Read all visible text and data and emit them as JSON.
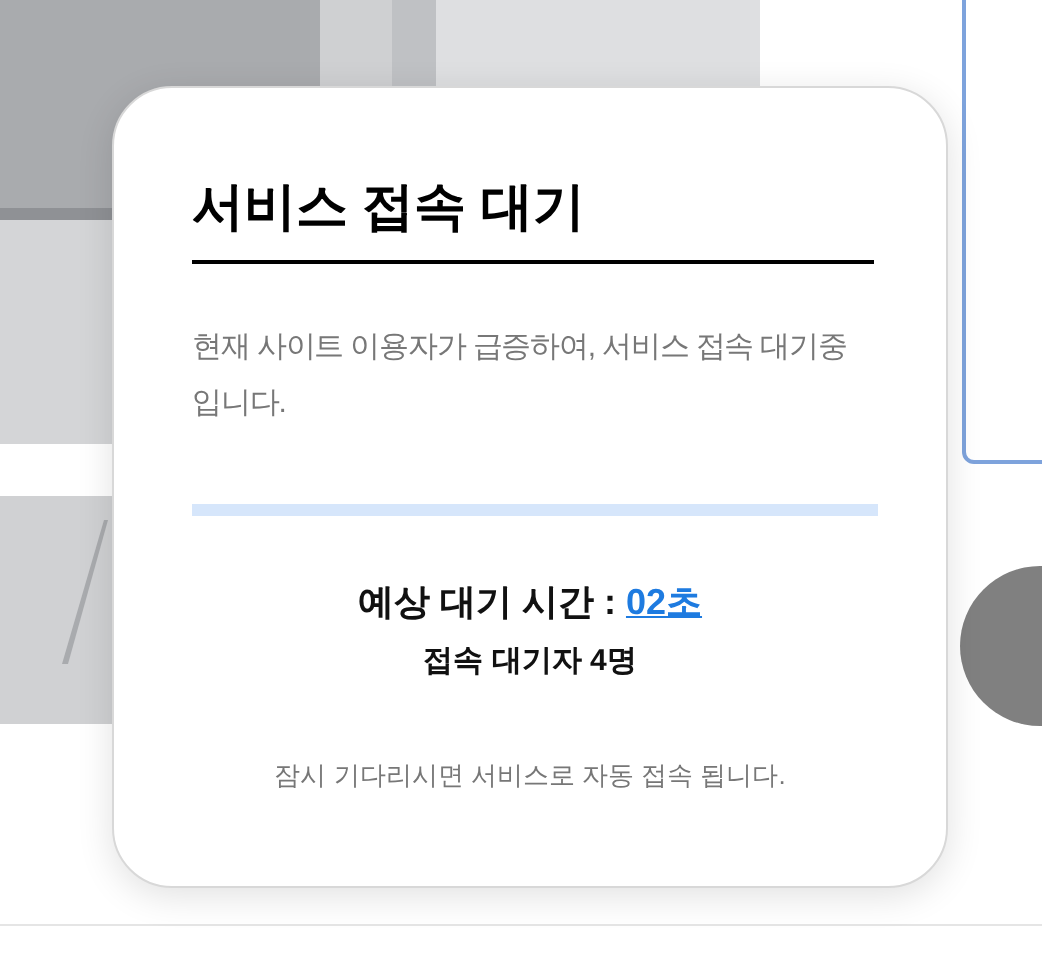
{
  "modal": {
    "title": "서비스 접속 대기",
    "description": "현재 사이트 이용자가 급증하여, 서비스 접속 대기중 입니다.",
    "wait_time": {
      "label": "예상 대기 시간 :",
      "value": "02초"
    },
    "queue": "접속 대기자 4명",
    "footer": "잠시 기다리시면 서비스로 자동 접속 됩니다."
  }
}
